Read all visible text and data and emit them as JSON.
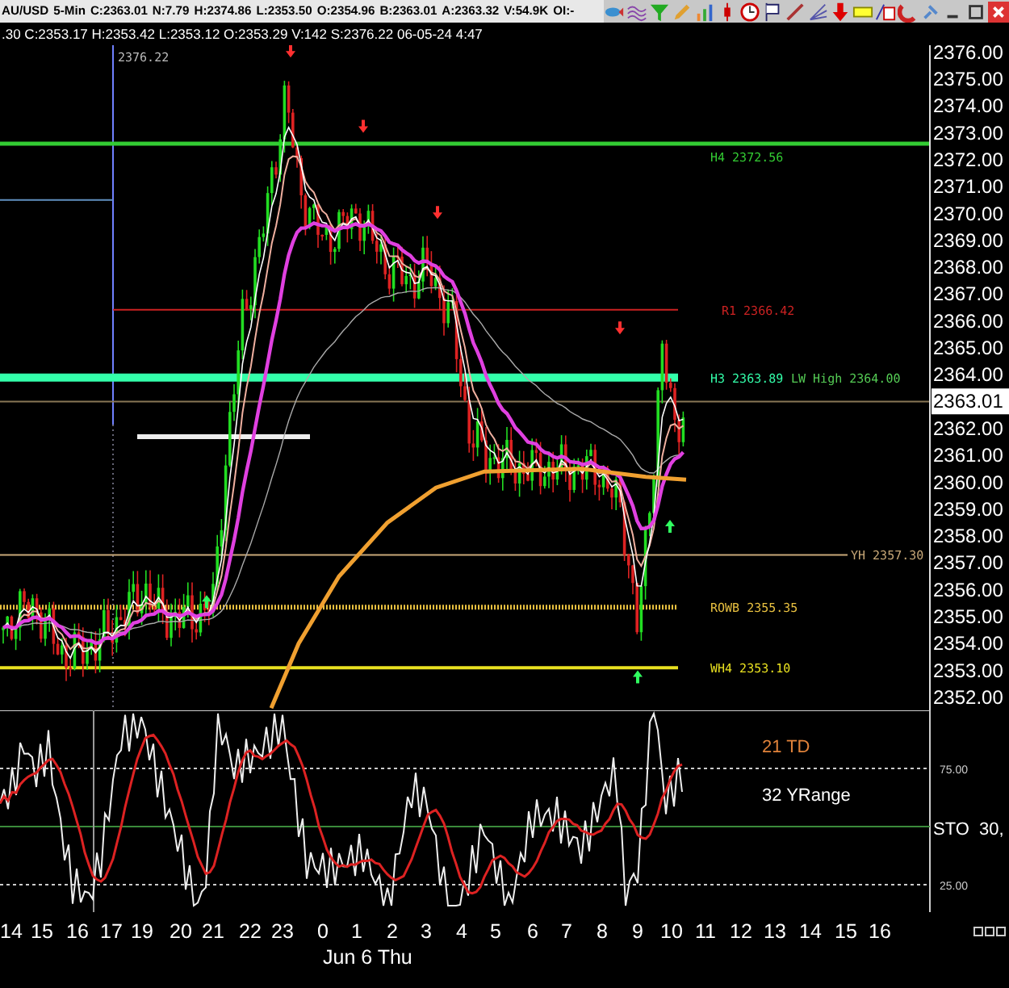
{
  "header": {
    "fields": [
      "AU/USD",
      "5-Min",
      "C:2363.01",
      "N:7.79",
      "H:2374.86",
      "L:2353.50",
      "O:2354.96",
      "B:2363.01",
      "A:2363.32",
      "V:54.9K",
      "OI:-"
    ]
  },
  "bar_info": ".30 C:2353.17 H:2353.42 L:2353.12 O:2353.29 V:142 S:2376.22 06-05-24 4:47",
  "price_chart": {
    "marker_label": "2376.22",
    "price_levels": [
      {
        "label": "H4 2372.56",
        "color": "#33cc33"
      },
      {
        "label": "R1 2366.42",
        "color": "#cc2222"
      },
      {
        "label": "H3 2363.89",
        "color": "#33ffaa"
      },
      {
        "label": "YH 2357.30",
        "color": "#c8a878"
      },
      {
        "label": "ROWB 2355.35",
        "color": "#e8c040"
      },
      {
        "label": "WH4 2353.10",
        "color": "#e8e020"
      }
    ],
    "extra_label": "LW High 2364.00",
    "axis_labels": [
      "2376.00",
      "2375.00",
      "2374.00",
      "2373.00",
      "2372.00",
      "2371.00",
      "2370.00",
      "2369.00",
      "2368.00",
      "2367.00",
      "2366.00",
      "2365.00",
      "2364.00",
      "2362.00",
      "2361.00",
      "2360.00",
      "2359.00",
      "2358.00",
      "2357.00",
      "2356.00",
      "2355.00",
      "2354.00",
      "2353.00",
      "2352.00"
    ],
    "current_price": "2363.01"
  },
  "oscillator": {
    "labels": [
      {
        "text": "21 TD",
        "color": "#e0823a"
      },
      {
        "text": "32 YRange",
        "color": "#ffffff"
      }
    ],
    "axis_labels": [
      "75.00",
      "25.00"
    ],
    "name": "STO  30,"
  },
  "time_axis": {
    "hours": [
      "14",
      "15",
      "16",
      "17",
      "19",
      "20",
      "21",
      "22",
      "23",
      "0",
      "1",
      "2",
      "3",
      "4",
      "5",
      "6",
      "7",
      "8",
      "9",
      "10",
      "11",
      "12",
      "13",
      "14",
      "15",
      "16"
    ],
    "date": "Jun 6 Thu"
  }
}
